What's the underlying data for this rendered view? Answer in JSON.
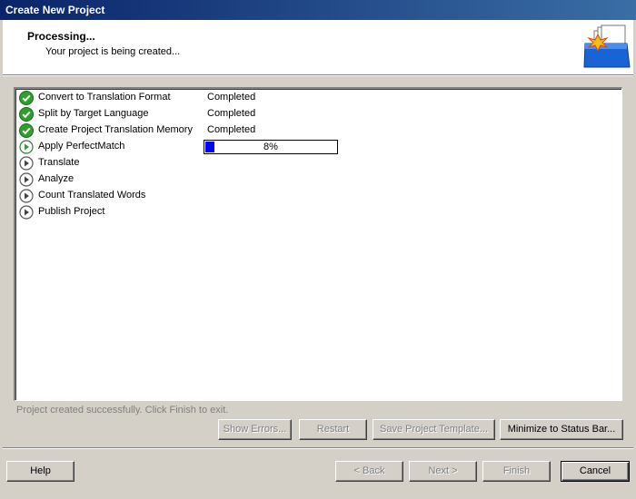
{
  "window": {
    "title": "Create New Project"
  },
  "header": {
    "title": "Processing...",
    "subtitle": "Your project is being created...",
    "icon": "project-folder-icon"
  },
  "steps": [
    {
      "label": "Convert to Translation Format",
      "status": "Completed",
      "state": "done"
    },
    {
      "label": "Split by Target Language",
      "status": "Completed",
      "state": "done"
    },
    {
      "label": "Create Project Translation Memory",
      "status": "Completed",
      "state": "done"
    },
    {
      "label": "Apply PerfectMatch",
      "status": "",
      "state": "in-progress",
      "progress": 8,
      "progress_text": "8%"
    },
    {
      "label": "Translate",
      "status": "",
      "state": "pending"
    },
    {
      "label": "Analyze",
      "status": "",
      "state": "pending"
    },
    {
      "label": "Count Translated Words",
      "status": "",
      "state": "pending"
    },
    {
      "label": "Publish Project",
      "status": "",
      "state": "pending"
    }
  ],
  "status_message": "Project created successfully. Click Finish to exit.",
  "buttons": {
    "show_errors": "Show Errors...",
    "restart": "Restart",
    "save_template": "Save Project Template...",
    "minimize": "Minimize to Status Bar...",
    "help": "Help",
    "back": "< Back",
    "next": "Next >",
    "finish": "Finish",
    "cancel": "Cancel"
  },
  "colors": {
    "title_gradient_start": "#0a246a",
    "title_gradient_end": "#3a6ea5",
    "progress_fill": "#0000ff",
    "done_icon": "#2e9e2e"
  }
}
